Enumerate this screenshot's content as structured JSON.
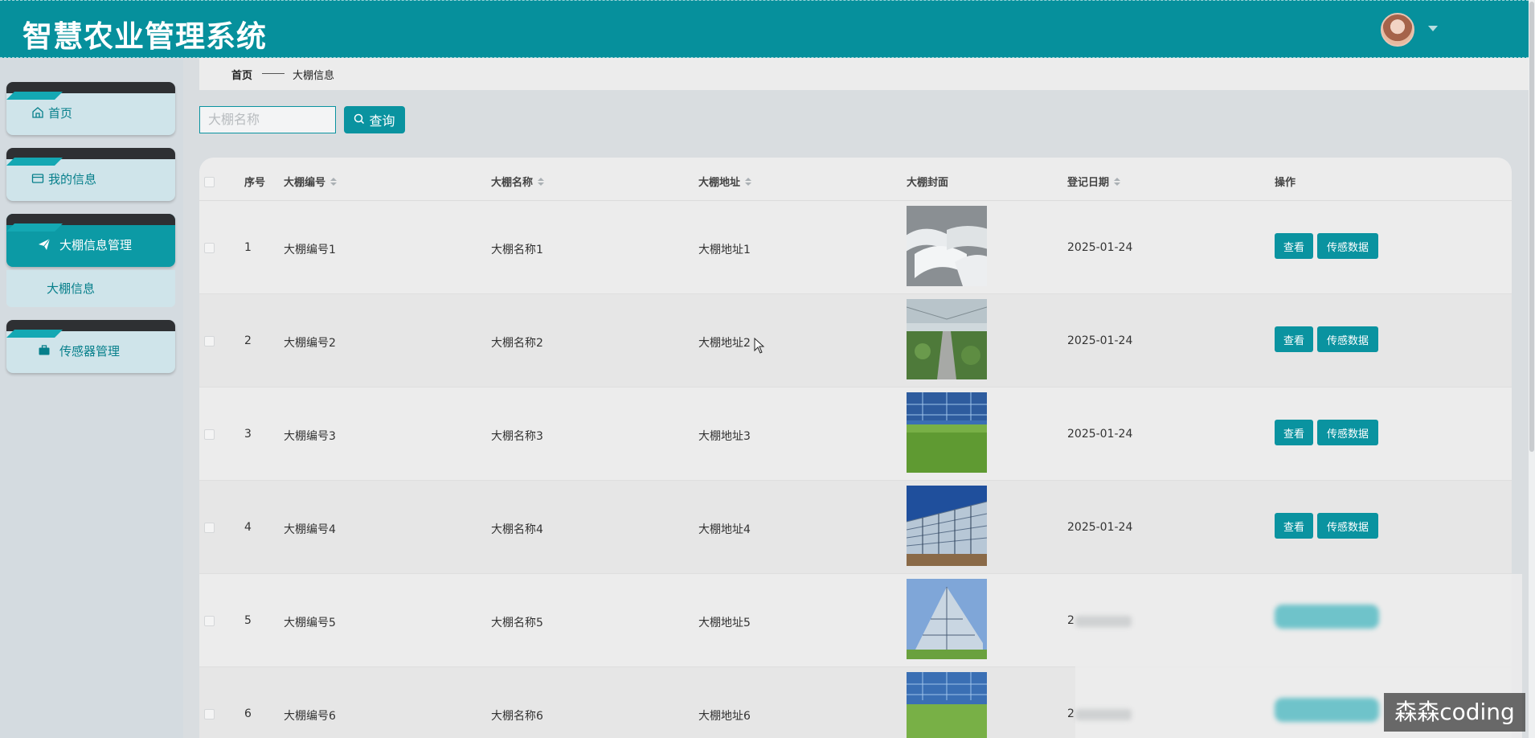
{
  "app": {
    "title": "智慧农业管理系统"
  },
  "sidebar": {
    "items": [
      {
        "label": "首页",
        "icon": "home-icon"
      },
      {
        "label": "我的信息",
        "icon": "card-icon"
      },
      {
        "label": "大棚信息管理",
        "icon": "send-icon",
        "active": true,
        "children": [
          {
            "label": "大棚信息"
          }
        ]
      },
      {
        "label": "传感器管理",
        "icon": "briefcase-icon"
      }
    ]
  },
  "breadcrumb": {
    "home": "首页",
    "current": "大棚信息"
  },
  "search": {
    "placeholder": "大棚名称",
    "button_label": "查询"
  },
  "table": {
    "headers": {
      "index": "序号",
      "code": "大棚编号",
      "name": "大棚名称",
      "address": "大棚地址",
      "cover": "大棚封面",
      "date": "登记日期",
      "actions": "操作"
    },
    "view_label": "查看",
    "sensor_label": "传感数据",
    "rows": [
      {
        "index": "1",
        "code": "大棚编号1",
        "name": "大棚名称1",
        "address": "大棚地址1",
        "date": "2025-01-24"
      },
      {
        "index": "2",
        "code": "大棚编号2",
        "name": "大棚名称2",
        "address": "大棚地址2",
        "date": "2025-01-24"
      },
      {
        "index": "3",
        "code": "大棚编号3",
        "name": "大棚名称3",
        "address": "大棚地址3",
        "date": "2025-01-24"
      },
      {
        "index": "4",
        "code": "大棚编号4",
        "name": "大棚名称4",
        "address": "大棚地址4",
        "date": "2025-01-24"
      },
      {
        "index": "5",
        "code": "大棚编号5",
        "name": "大棚名称5",
        "address": "大棚地址5",
        "date": "2"
      },
      {
        "index": "6",
        "code": "大棚编号6",
        "name": "大棚名称6",
        "address": "大棚地址6",
        "date": "2"
      }
    ]
  },
  "watermark": "森森coding",
  "colors": {
    "primary": "#0a93a0",
    "header": "#06909c",
    "sidebar_bg": "#d4dbe0"
  }
}
